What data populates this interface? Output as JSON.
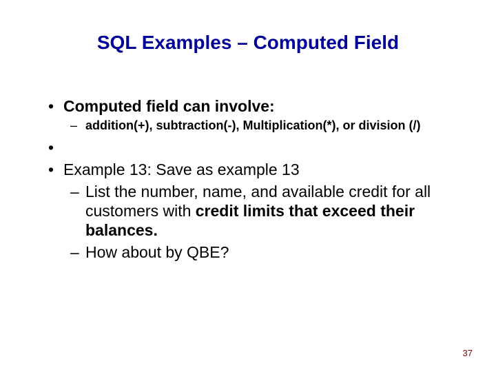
{
  "title": "SQL Examples – Computed Field",
  "bullets": {
    "b1": {
      "text": "Computed field can involve:",
      "sub": {
        "s1": "addition(+), subtraction(-), Multiplication(*), or division (/)"
      }
    },
    "b2": {
      "text": "Example 13: Save as example 13",
      "sub": {
        "s1_pre": "List the number, name, and available credit for all customers with ",
        "s1_bold": "credit limits that exceed their balances.",
        "s2": "How about by QBE?"
      }
    }
  },
  "page_number": "37"
}
